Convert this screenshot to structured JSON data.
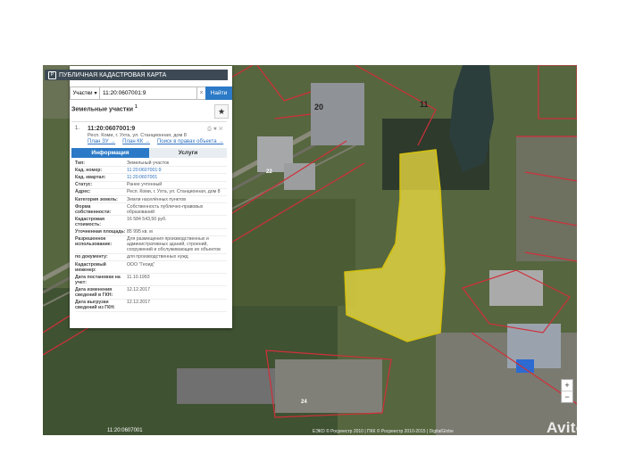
{
  "app": {
    "title": "ПУБЛИЧНАЯ КАДАСТРОВАЯ КАРТА"
  },
  "search": {
    "type_label": "Участки",
    "query": "11:20:0607001:9",
    "button": "Найти"
  },
  "results": {
    "header": "Земельные участки",
    "count": "1"
  },
  "item": {
    "index": "1.",
    "cad_number": "11:20:0607001:9",
    "address": "Респ. Коми, г. Ухта, ул. Станционная, дом 8",
    "links": [
      "План ЗУ →",
      "План КК →",
      "Поиск в правах объекта →"
    ]
  },
  "tabs": {
    "info": "Информация",
    "services": "Услуги"
  },
  "info": [
    {
      "k": "Тип:",
      "v": "Земельный участок",
      "link": false
    },
    {
      "k": "Кад. номер:",
      "v": "11:20:0607001:9",
      "link": true
    },
    {
      "k": "Кад. квартал:",
      "v": "11:20:0607001",
      "link": true
    },
    {
      "k": "Статус:",
      "v": "Ранее учтенный",
      "link": false
    },
    {
      "k": "Адрес:",
      "v": "Респ. Коми, г. Ухта, ул. Станционная, дом 8",
      "link": false
    },
    {
      "k": "Категория земель:",
      "v": "Земли населённых пунктов",
      "link": false
    },
    {
      "k": "Форма собственности:",
      "v": "Собственность публично-правовых образований",
      "link": false
    },
    {
      "k": "Кадастровая стоимость:",
      "v": "16 584 543,50 руб.",
      "link": false
    },
    {
      "k": "Уточненная площадь:",
      "v": "85 995 кв. м",
      "link": false
    },
    {
      "k": "Разрешенное использование:",
      "v": "Для размещения производственных и административных зданий, строений, сооружений и обслуживающих их объектов",
      "link": false
    },
    {
      "k": "по документу:",
      "v": "для производственных нужд",
      "link": false
    },
    {
      "k": "Кадастровый инженер:",
      "v": "ООО \"Геоид\"",
      "link": false
    },
    {
      "k": "Дата постановки на учет:",
      "v": "11.10.1993",
      "link": false
    },
    {
      "k": "Дата изменения сведений в ГКН:",
      "v": "12.12.2017",
      "link": false
    },
    {
      "k": "Дата выгрузки сведений из ГКН:",
      "v": "12.12.2017",
      "link": false
    }
  ],
  "map": {
    "labels": [
      "20",
      "11",
      "22",
      "24"
    ],
    "copyright": "ЕЭКО © Росреестр 2010 | ПКК © Росреестр 2010-2015 | DigitalGlobe",
    "bottom_code": "11:20:0607001"
  },
  "zoom": {
    "plus": "+",
    "minus": "−"
  },
  "watermark": "Avito",
  "colors": {
    "accent": "#2c7ac7",
    "highlight": "#f0e040",
    "boundary": "#d0303a"
  }
}
